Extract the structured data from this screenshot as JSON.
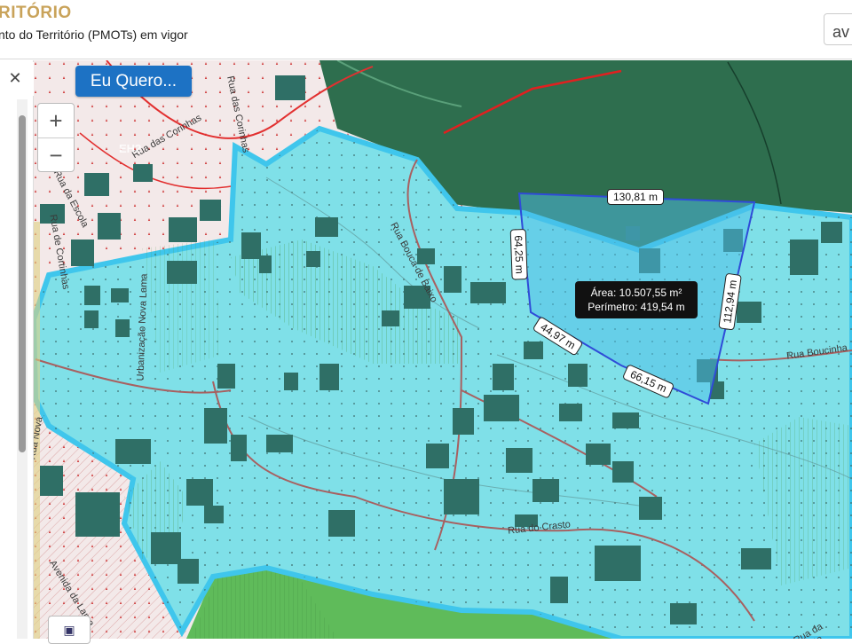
{
  "header": {
    "brand": "RITÓRIO",
    "subtitle": "nto do Território (PMOTs) em vigor",
    "search_value": "av"
  },
  "panel": {
    "close_icon": "close-icon",
    "collapse_icon": "chevron-left-icon"
  },
  "map": {
    "eu_button": "Eu Quero...",
    "zoom_in": "+",
    "zoom_out": "−",
    "measure": {
      "top": "130,81 m",
      "left": "64,25 m",
      "right": "112,94 m",
      "bottom_left": "44,97 m",
      "bottom_right": "66,15 m",
      "area": "Área: 10.507,55 m²",
      "perimeter": "Perímetro: 419,54 m"
    },
    "streets": {
      "corinhas": "Rua das Corinhas",
      "corinhas_vertical": "Rua das Corinhas",
      "escola": "Rua da Escola",
      "cortinhas": "Rua de Cortinhas",
      "urbanizacao": "Urbanização Nova Lama",
      "bouca": "Rua Bouca de Baixo",
      "crasto": "Rua do Crasto",
      "lama": "Avenida da Lama",
      "nova": "Rua Nova",
      "bouca_right": "Rua Boucinha",
      "costa": "Rua da Costa"
    },
    "zone_label": "EH2",
    "colors": {
      "zone_fill": "#7fe0e8",
      "zone_border": "#3fc6ec",
      "forest": "#2e6e4e",
      "green": "#5fbb5a",
      "polygon": "#2f4bd8"
    }
  }
}
